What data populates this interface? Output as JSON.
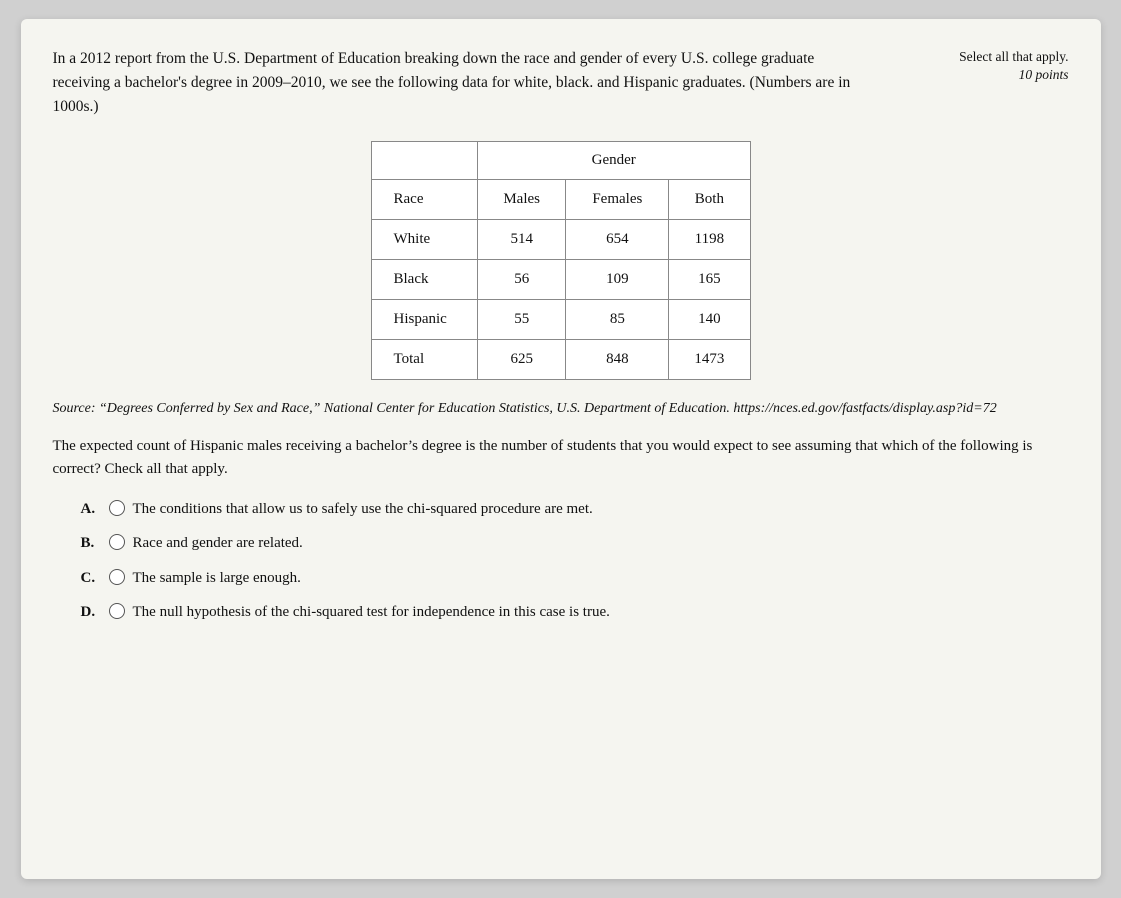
{
  "meta": {
    "select_all_label": "Select all that apply.",
    "points_label": "10 points"
  },
  "intro": {
    "text": "In a 2012 report from the U.S. Department of Education breaking down the race and gender of every U.S. college graduate receiving a bachelor's degree in 2009–2010, we see the following data for white, black. and Hispanic graduates. (Numbers are in 1000s.)"
  },
  "table": {
    "gender_header": "Gender",
    "columns": [
      "Race",
      "Males",
      "Females",
      "Both"
    ],
    "rows": [
      {
        "race": "White",
        "males": "514",
        "females": "654",
        "both": "1198"
      },
      {
        "race": "Black",
        "males": "56",
        "females": "109",
        "both": "165"
      },
      {
        "race": "Hispanic",
        "males": "55",
        "females": "85",
        "both": "140"
      },
      {
        "race": "Total",
        "males": "625",
        "females": "848",
        "both": "1473"
      }
    ]
  },
  "source": {
    "text": "Source: “Degrees Conferred by Sex and Race,” National Center for Education Statistics, U.S. Department of Education. https://nces.ed.gov/fastfacts/display.asp?id=72"
  },
  "question": {
    "text": "The expected count of Hispanic males receiving a bachelor’s degree is the number of students that you would expect to see assuming that which of the following is correct? Check all that apply."
  },
  "options": [
    {
      "letter": "A.",
      "text": "The conditions that allow us to safely use the chi-squared procedure are met."
    },
    {
      "letter": "B.",
      "text": "Race and gender are related."
    },
    {
      "letter": "C.",
      "text": "The sample is large enough."
    },
    {
      "letter": "D.",
      "text": "The null hypothesis of the chi-squared test for independence in this case is true."
    }
  ]
}
